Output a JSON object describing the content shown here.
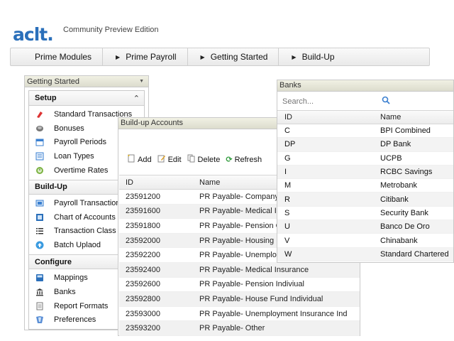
{
  "brand": {
    "logo": "aclt.",
    "edition": "Community Preview Edition"
  },
  "topnav": {
    "items": [
      {
        "label": "Prime Modules",
        "arrow": false
      },
      {
        "label": "Prime Payroll",
        "arrow": true
      },
      {
        "label": "Getting Started",
        "arrow": true
      },
      {
        "label": "Build-Up",
        "arrow": true
      }
    ]
  },
  "getting_started": {
    "title": "Getting Started",
    "sections": [
      {
        "title": "Setup",
        "items": [
          {
            "label": "Standard Transactions",
            "icon": "tag-icon"
          },
          {
            "label": "Bonuses",
            "icon": "coins-icon"
          },
          {
            "label": "Payroll Periods",
            "icon": "calendar-icon"
          },
          {
            "label": "Loan Types",
            "icon": "form-icon"
          },
          {
            "label": "Overtime Rates",
            "icon": "clock-icon"
          }
        ]
      },
      {
        "title": "Build-Up",
        "items": [
          {
            "label": "Payroll Transactions",
            "icon": "payroll-icon"
          },
          {
            "label": "Chart of Accounts",
            "icon": "chart-accounts-icon"
          },
          {
            "label": "Transaction Class",
            "icon": "list-icon"
          },
          {
            "label": "Batch Uplaod",
            "icon": "upload-icon"
          }
        ]
      },
      {
        "title": "Configure",
        "items": [
          {
            "label": "Mappings",
            "icon": "mappings-icon"
          },
          {
            "label": "Banks",
            "icon": "bank-icon"
          },
          {
            "label": "Report Formats",
            "icon": "report-icon"
          },
          {
            "label": "Preferences",
            "icon": "preferences-icon"
          }
        ]
      }
    ]
  },
  "buildup_accounts": {
    "title": "Build-up Accounts",
    "toolbar": {
      "add": "Add",
      "edit": "Edit",
      "delete": "Delete",
      "refresh": "Refresh"
    },
    "columns": {
      "id": "ID",
      "name": "Name"
    },
    "rows": [
      {
        "id": "23591200",
        "name": "PR Payable- Company H"
      },
      {
        "id": "23591600",
        "name": "PR Payable- Medical Ins"
      },
      {
        "id": "23591800",
        "name": "PR Payable- Pension Co"
      },
      {
        "id": "23592000",
        "name": "PR Payable- Housing Fu"
      },
      {
        "id": "23592200",
        "name": "PR Payable- Unemploym"
      },
      {
        "id": "23592400",
        "name": "PR Payable- Medical Insurance"
      },
      {
        "id": "23592600",
        "name": "PR Payable- Pension Indiviual"
      },
      {
        "id": "23592800",
        "name": "PR Payable- House Fund Individual"
      },
      {
        "id": "23593000",
        "name": "PR Payable- Unemployment Insurance Ind"
      },
      {
        "id": "23593200",
        "name": "PR Payable- Other"
      }
    ]
  },
  "banks": {
    "title": "Banks",
    "search": {
      "placeholder": "Search..."
    },
    "columns": {
      "id": "ID",
      "name": "Name"
    },
    "rows": [
      {
        "id": "C",
        "name": "BPI Combined"
      },
      {
        "id": "DP",
        "name": "DP Bank"
      },
      {
        "id": "G",
        "name": "UCPB"
      },
      {
        "id": "I",
        "name": "RCBC Savings"
      },
      {
        "id": "M",
        "name": "Metrobank"
      },
      {
        "id": "R",
        "name": "Citibank"
      },
      {
        "id": "S",
        "name": "Security Bank"
      },
      {
        "id": "U",
        "name": "Banco De Oro"
      },
      {
        "id": "V",
        "name": "Chinabank"
      },
      {
        "id": "W",
        "name": "Standard Chartered"
      }
    ]
  }
}
